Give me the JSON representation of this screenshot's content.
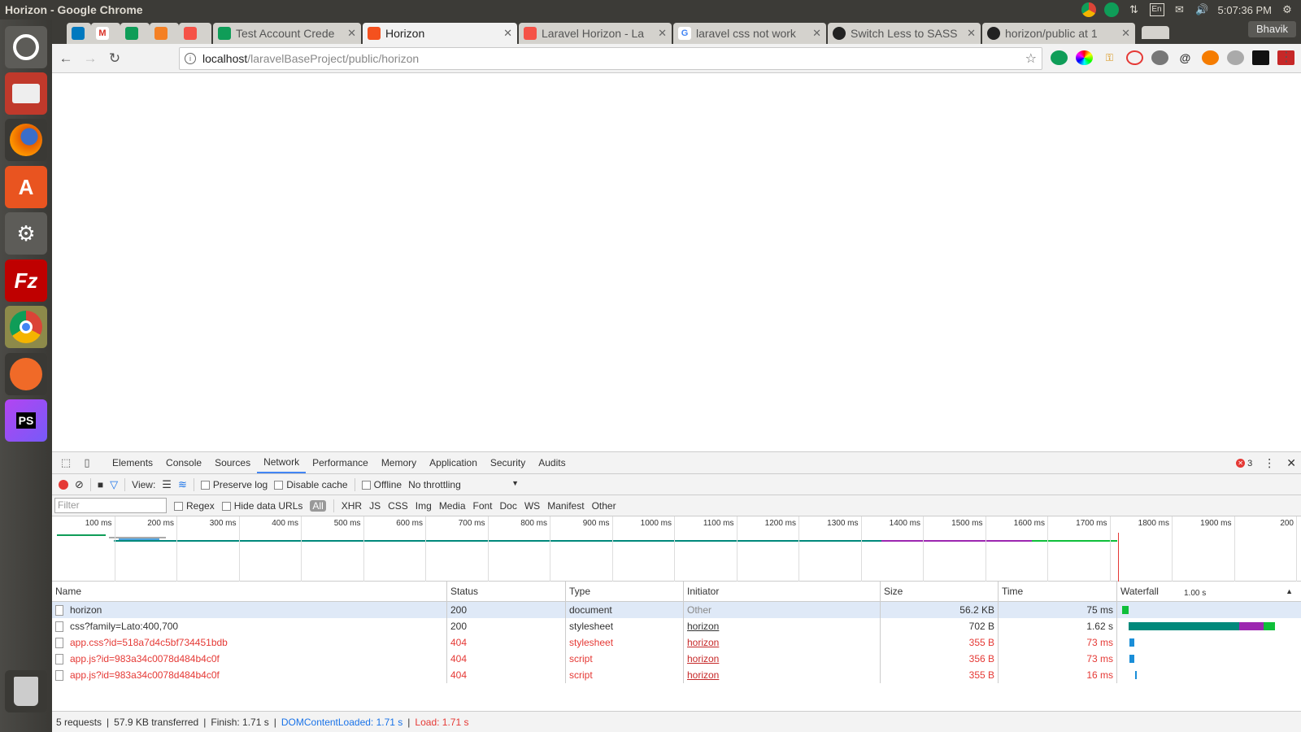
{
  "window": {
    "title": "Horizon - Google Chrome",
    "clock": "5:07:36 PM",
    "keyboard": "En",
    "profile": "Bhavik"
  },
  "tabs": [
    {
      "label": "Test Account Crede",
      "favicon": "sheets-icon"
    },
    {
      "label": "Horizon",
      "favicon": "horizon-icon",
      "active": true
    },
    {
      "label": "Laravel Horizon - La",
      "favicon": "laravel-icon"
    },
    {
      "label": "laravel css not work",
      "favicon": "google-icon"
    },
    {
      "label": "Switch Less to SASS",
      "favicon": "github-icon"
    },
    {
      "label": "horizon/public at 1",
      "favicon": "github-icon"
    }
  ],
  "address": {
    "host": "localhost",
    "path": "/laravelBaseProject/public/horizon"
  },
  "devtools": {
    "tabs": [
      "Elements",
      "Console",
      "Sources",
      "Network",
      "Performance",
      "Memory",
      "Application",
      "Security",
      "Audits"
    ],
    "active_tab": "Network",
    "error_count": "3",
    "toolbar": {
      "view_label": "View:",
      "preserve_log": "Preserve log",
      "disable_cache": "Disable cache",
      "offline": "Offline",
      "throttling": "No throttling"
    },
    "filter": {
      "placeholder": "Filter",
      "regex": "Regex",
      "hide_data_urls": "Hide data URLs",
      "types": [
        "All",
        "XHR",
        "JS",
        "CSS",
        "Img",
        "Media",
        "Font",
        "Doc",
        "WS",
        "Manifest",
        "Other"
      ]
    },
    "timeline_ticks": [
      "100 ms",
      "200 ms",
      "300 ms",
      "400 ms",
      "500 ms",
      "600 ms",
      "700 ms",
      "800 ms",
      "900 ms",
      "1000 ms",
      "1100 ms",
      "1200 ms",
      "1300 ms",
      "1400 ms",
      "1500 ms",
      "1600 ms",
      "1700 ms",
      "1800 ms",
      "1900 ms",
      "200"
    ],
    "columns": {
      "name": "Name",
      "status": "Status",
      "type": "Type",
      "initiator": "Initiator",
      "size": "Size",
      "time": "Time",
      "waterfall": "Waterfall",
      "waterfall_scale": "1.00 s"
    },
    "requests": [
      {
        "name": "horizon",
        "status": "200",
        "type": "document",
        "initiator": "Other",
        "size": "56.2 KB",
        "time": "75 ms",
        "error": false
      },
      {
        "name": "css?family=Lato:400,700",
        "status": "200",
        "type": "stylesheet",
        "initiator": "horizon",
        "size": "702 B",
        "time": "1.62 s",
        "error": false
      },
      {
        "name": "app.css?id=518a7d4c5bf734451bdb",
        "status": "404",
        "type": "stylesheet",
        "initiator": "horizon",
        "size": "355 B",
        "time": "73 ms",
        "error": true
      },
      {
        "name": "app.js?id=983a34c0078d484b4c0f",
        "status": "404",
        "type": "script",
        "initiator": "horizon",
        "size": "356 B",
        "time": "73 ms",
        "error": true
      },
      {
        "name": "app.js?id=983a34c0078d484b4c0f",
        "status": "404",
        "type": "script",
        "initiator": "horizon",
        "size": "355 B",
        "time": "16 ms",
        "error": true
      }
    ],
    "summary": {
      "requests": "5 requests",
      "transferred": "57.9 KB transferred",
      "finish": "Finish: 1.71 s",
      "dom_loaded": "DOMContentLoaded: 1.71 s",
      "load": "Load: 1.71 s"
    }
  }
}
